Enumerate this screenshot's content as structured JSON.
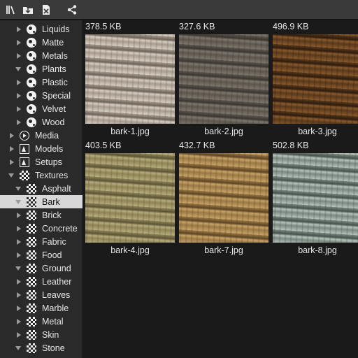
{
  "toolbar": {
    "buttons": [
      {
        "icon": "library-icon"
      },
      {
        "icon": "import-folder-icon"
      },
      {
        "icon": "delete-file-icon"
      },
      {
        "icon": "share-icon"
      }
    ]
  },
  "sidebar": {
    "items": [
      {
        "label": "Liquids",
        "icon": "ball-icon",
        "expand": "right"
      },
      {
        "label": "Matte",
        "icon": "ball-icon",
        "expand": "right"
      },
      {
        "label": "Metals",
        "icon": "ball-icon",
        "expand": "right"
      },
      {
        "label": "Plants",
        "icon": "ball-icon",
        "expand": "down"
      },
      {
        "label": "Plastic",
        "icon": "ball-icon",
        "expand": "right"
      },
      {
        "label": "Special",
        "icon": "ball-icon",
        "expand": "right"
      },
      {
        "label": "Velvet",
        "icon": "ball-icon",
        "expand": "right"
      },
      {
        "label": "Wood",
        "icon": "ball-icon",
        "expand": "right"
      },
      {
        "label": "Media",
        "icon": "media-icon",
        "expand": "right"
      },
      {
        "label": "Models",
        "icon": "model-icon",
        "expand": "right"
      },
      {
        "label": "Setups",
        "icon": "model-icon",
        "expand": "right"
      },
      {
        "label": "Textures",
        "icon": "checker-icon",
        "expand": "down"
      },
      {
        "label": "Asphalt",
        "icon": "checker-icon",
        "expand": "down"
      },
      {
        "label": "Bark",
        "icon": "checker-icon",
        "expand": "down",
        "selected": true
      },
      {
        "label": "Brick",
        "icon": "checker-icon",
        "expand": "right"
      },
      {
        "label": "Concrete",
        "icon": "checker-icon",
        "expand": "right"
      },
      {
        "label": "Fabric",
        "icon": "checker-icon",
        "expand": "right"
      },
      {
        "label": "Food",
        "icon": "checker-icon",
        "expand": "right"
      },
      {
        "label": "Ground",
        "icon": "checker-icon",
        "expand": "down"
      },
      {
        "label": "Leather",
        "icon": "checker-icon",
        "expand": "right"
      },
      {
        "label": "Leaves",
        "icon": "checker-icon",
        "expand": "right"
      },
      {
        "label": "Marble",
        "icon": "checker-icon",
        "expand": "right"
      },
      {
        "label": "Metal",
        "icon": "checker-icon",
        "expand": "right"
      },
      {
        "label": "Skin",
        "icon": "checker-icon",
        "expand": "right"
      },
      {
        "label": "Stone",
        "icon": "checker-icon",
        "expand": "down"
      }
    ]
  },
  "files": [
    {
      "size": "378.5 KB",
      "name": "bark-1.jpg",
      "tone": [
        "#d8cfc4",
        "#a99d90",
        "#6e6359"
      ]
    },
    {
      "size": "327.6 KB",
      "name": "bark-2.jpg",
      "tone": [
        "#7e776d",
        "#5e574f",
        "#3b3631"
      ]
    },
    {
      "size": "496.9 KB",
      "name": "bark-3.jpg",
      "tone": [
        "#8a5a2e",
        "#5b3a1c",
        "#2e1c0d"
      ]
    },
    {
      "size": "403.5 KB",
      "name": "bark-4.jpg",
      "tone": [
        "#b7ad7d",
        "#8f8558",
        "#5c5436"
      ]
    },
    {
      "size": "432.7 KB",
      "name": "bark-7.jpg",
      "tone": [
        "#c9a468",
        "#9c7a45",
        "#5d4424"
      ]
    },
    {
      "size": "502.8 KB",
      "name": "bark-8.jpg",
      "tone": [
        "#b8c4bd",
        "#7c8a82",
        "#46524b"
      ]
    }
  ]
}
